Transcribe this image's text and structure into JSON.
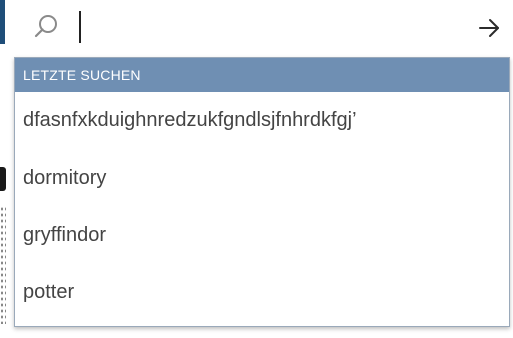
{
  "search": {
    "value": "",
    "placeholder": "",
    "icon": "search-icon",
    "submit_icon": "arrow-right-icon"
  },
  "recent": {
    "header": "LETZTE SUCHEN",
    "items": [
      "dfasnfxkduighnredzukfgndlsjfnhrdkfgj’",
      "dormitory",
      "gryffindor",
      "potter"
    ]
  },
  "colors": {
    "header_bg": "#6f8fb3",
    "header_text": "#ffffff",
    "item_text": "#444444",
    "accent": "#1f4e79"
  }
}
